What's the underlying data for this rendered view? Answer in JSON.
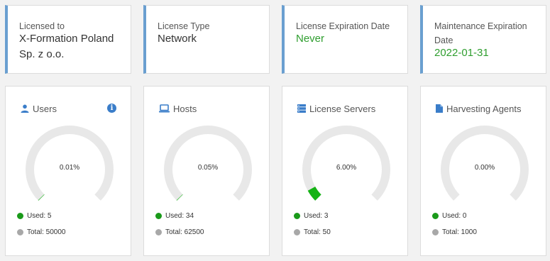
{
  "info_cards": [
    {
      "label": "Licensed to",
      "value": "X-Formation Poland Sp. z o.o."
    },
    {
      "label": "License Type",
      "value": "Network"
    },
    {
      "label": "License Expiration Date",
      "value": "Never"
    },
    {
      "label": "Maintenance Expiration Date",
      "value": "2022-01-31"
    }
  ],
  "stat_cards": [
    {
      "title": "Users",
      "icon": "user-icon",
      "percent": "0.01%",
      "fraction": 0.0001,
      "used_label": "Used: 5",
      "total_label": "Total: 50000"
    },
    {
      "title": "Hosts",
      "icon": "laptop-icon",
      "percent": "0.05%",
      "fraction": 0.0005,
      "used_label": "Used: 34",
      "total_label": "Total: 62500"
    },
    {
      "title": "License Servers",
      "icon": "server-icon",
      "percent": "6.00%",
      "fraction": 0.06,
      "used_label": "Used: 3",
      "total_label": "Total: 50"
    },
    {
      "title": "Harvesting Agents",
      "icon": "document-icon",
      "percent": "0.00%",
      "fraction": 0.0,
      "used_label": "Used: 0",
      "total_label": "Total: 1000"
    }
  ],
  "colors": {
    "accent": "#6a9fd0",
    "icon_blue": "#3a7dc9",
    "green_text": "#2f9e2f",
    "gauge_fill": "#15b315",
    "gauge_track": "#e8e8e8",
    "used_dot": "#1a9a1a",
    "total_dot": "#a8a8a8"
  }
}
